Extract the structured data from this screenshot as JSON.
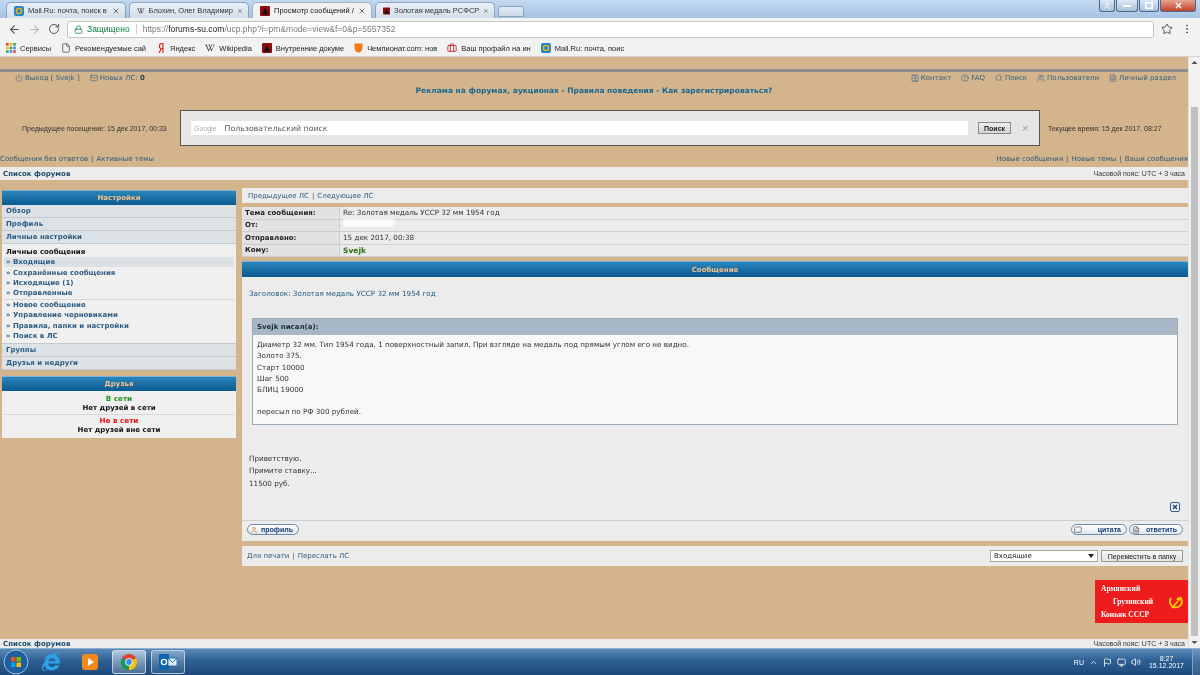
{
  "browser": {
    "tabs": [
      {
        "title": "Mail.Ru: почта, поиск в",
        "kind": "mailru",
        "selected": false
      },
      {
        "title": "Блохин, Олег Владимир",
        "kind": "wiki",
        "selected": false
      },
      {
        "title": "Просмотр сообщений /",
        "kind": "forum",
        "selected": true
      },
      {
        "title": "Золотая медаль РСФСР",
        "kind": "forum",
        "selected": false
      }
    ],
    "address_bar": {
      "security": "Защищено",
      "scheme": "https://",
      "host": "forums-su.com",
      "path": "/ucp.php?i=pm&mode=view&f=0&p=5557352"
    },
    "bookmarks": [
      {
        "label": "Сервисы",
        "kind": "apps"
      },
      {
        "label": "Рекомендуемые сай",
        "kind": "page"
      },
      {
        "label": "Яндекс",
        "kind": "yandex"
      },
      {
        "label": "Wikipedia",
        "kind": "wiki"
      },
      {
        "label": "Внутренние докуме",
        "kind": "forum"
      },
      {
        "label": "Чемпионат.com: нов",
        "kind": "championat"
      },
      {
        "label": "Ваш профайл на ин",
        "kind": "briefcase"
      },
      {
        "label": "Mail.Ru: почта, поис",
        "kind": "mailru"
      }
    ]
  },
  "header": {
    "logout": "Выход [ Svejk ]",
    "new_pm": "Новых ЛС: **0**",
    "nav_links": [
      {
        "label": "Контакт",
        "kind": "contact"
      },
      {
        "label": "FAQ",
        "kind": "faq"
      },
      {
        "label": "Поиск",
        "kind": "search"
      },
      {
        "label": "Пользователи",
        "kind": "users"
      },
      {
        "label": "Личный раздел",
        "kind": "ucp"
      }
    ],
    "announcement": "Реклама на форумах, аукционах - Правила поведения - Как зарегистрироваться?",
    "last_visit": "Предыдущее посещение: 15 дек 2017, 00:33",
    "search": {
      "brand": "Google",
      "placeholder": "Пользовательский поиск",
      "button": "Поиск",
      "clear": "×"
    },
    "current_time": "Текущее время: 15 дек 2017, 08:27",
    "quick_links_left": {
      "links": [
        "Сообщения без ответов",
        "Активные темы"
      ],
      "separator": "|"
    },
    "quick_links_right": {
      "links": [
        "Новые сообщения",
        "Новые темы",
        "Ваши сообщения"
      ],
      "separator": "|"
    },
    "breadcrumb": "Список форумов",
    "timezone": "Часовой пояс: UTC + 3 часа"
  },
  "sidebar": {
    "title": "Настройки",
    "items": [
      {
        "label": "Обзор",
        "kind": "link",
        "selected": false
      },
      {
        "label": "Профиль",
        "kind": "link",
        "selected": false
      },
      {
        "label": "Личные настройки",
        "kind": "link",
        "selected": false
      },
      {
        "label": "Личные сообщения",
        "kind": "group",
        "selected": false,
        "sections": [
          {
            "items": [
              {
                "label": "» Входящие",
                "selected": true
              },
              {
                "label": "» Сохранённые сообщения",
                "selected": false
              },
              {
                "label": "» Исходящие (1)",
                "selected": false
              },
              {
                "label": "» Отправленные",
                "selected": false
              }
            ]
          },
          {
            "items": [
              {
                "label": "» Новое сообщение",
                "selected": false
              },
              {
                "label": "» Управление черновиками",
                "selected": false
              },
              {
                "label": "» Правила, папки и настройки",
                "selected": false
              },
              {
                "label": "» Поиск в ЛС",
                "selected": false
              }
            ]
          }
        ]
      },
      {
        "label": "Группы",
        "kind": "link",
        "selected": false
      },
      {
        "label": "Друзья и недруги",
        "kind": "link",
        "selected": false
      }
    ]
  },
  "friends": {
    "title": "Друзья",
    "statuses": [
      {
        "label": "В сети",
        "color": "#229922",
        "note": "Нет друзей в сети"
      },
      {
        "label": "Не в сети",
        "color": "#ee1111",
        "note": "Нет друзей вне сети"
      }
    ]
  },
  "message": {
    "nav": {
      "links": [
        "Предыдущее ЛС",
        "Следующее ЛС"
      ],
      "separator": "|"
    },
    "fields": [
      {
        "label": "Тема сообщения:",
        "kind": "text",
        "value": "Re: Золотая медаль УССР 32 мм 1954 год"
      },
      {
        "label": "От:",
        "kind": "redacted"
      },
      {
        "label": "Отправлено:",
        "kind": "text",
        "value": "15 дек 2017, 00:38"
      },
      {
        "label": "Кому:",
        "kind": "user",
        "value": "Svejk"
      }
    ],
    "title": "Сообщение",
    "subject": "Заголовок: Золотая медаль УССР 32 мм 1954 год",
    "quote": {
      "author": "Svejk писал(а):",
      "paragraphs": [
        [
          "Диаметр 32 мм. Тип 1954 года, 1 поверхностный запил. При взгляде на медаль под прямым углом его не видно.",
          "Золото 375.",
          "Старт 10000",
          "Шаг 500",
          "БЛИЦ 19000"
        ],
        [
          "пересыл по РФ 300 рублей."
        ]
      ]
    },
    "body": [
      "Приветствую.",
      "Примите ставку...",
      "11500 руб."
    ],
    "profile_button": "профиль",
    "actions": [
      {
        "label": "цитата",
        "kind": "quote"
      },
      {
        "label": "ответить",
        "kind": "reply"
      }
    ],
    "footer_links": {
      "links": [
        "Для печати",
        "Переслать ЛС"
      ],
      "separator": "|"
    },
    "folder_select": "Входящие",
    "move_button": "Переместить в папку"
  },
  "ad": {
    "lines": [
      "Армянский",
      "Грузинский",
      "Коньяк СССР"
    ]
  },
  "footer": {
    "breadcrumb": "Список форумов",
    "timezone": "Часовой пояс: UTC + 3 часа"
  },
  "taskbar": {
    "apps": [
      {
        "kind": "ie",
        "running": false,
        "selected": false
      },
      {
        "kind": "media",
        "running": false,
        "selected": false
      },
      {
        "kind": "chrome",
        "running": true,
        "selected": true
      },
      {
        "kind": "outlook",
        "running": true,
        "selected": false
      }
    ],
    "language": "RU",
    "time": "8:27",
    "date": "15.12.2017"
  }
}
